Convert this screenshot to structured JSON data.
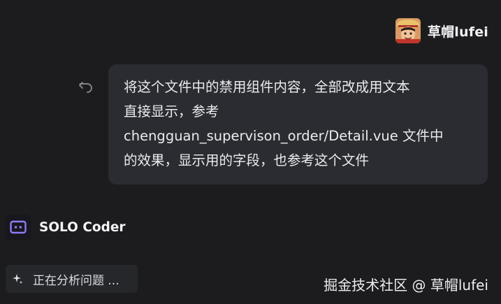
{
  "user": {
    "name": "草帽lufei",
    "avatar_icon": "avatar-image"
  },
  "message": {
    "lines": [
      "将这个文件中的禁用组件内容，全部改成用文本",
      "直接显示，参考",
      "chengguan_supervison_order/Detail.vue 文件中",
      "的效果，显示用的字段，也参考这个文件"
    ],
    "undo_icon": "undo-icon"
  },
  "agent": {
    "name": "SOLO Coder",
    "icon": "robot-icon",
    "accent": "#8b7cf6"
  },
  "status": {
    "text": "正在分析问题 ...",
    "icon": "sparkle-icon"
  },
  "watermark": {
    "text": "掘金技术社区 @ 草帽lufei"
  }
}
